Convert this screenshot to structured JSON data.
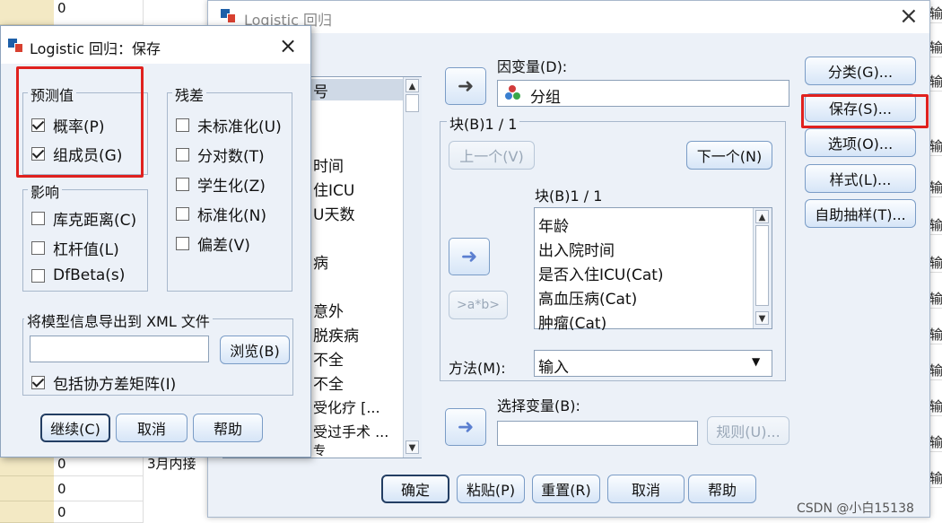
{
  "sheet": {
    "row_values": [
      "0",
      "0",
      "0"
    ],
    "third_col_text": "3月内接",
    "right_col_char": "输"
  },
  "main_dialog": {
    "title": "Logistic 回归",
    "variable_list": [
      "号",
      "",
      "",
      "时间",
      "住ICU",
      "U天数",
      "",
      "病",
      "",
      "",
      "意外",
      "脱疾病",
      "不全",
      "不全",
      "受化疗 [...",
      "受过手术 ...",
      "专"
    ],
    "dependent_label": "因变量(D):",
    "dependent_value": "分组",
    "block_label": "块(B)1 / 1",
    "prev_button": "上一个(V)",
    "next_button": "下一个(N)",
    "block_inner_label": "块(B)1 / 1",
    "covariates": [
      "年龄",
      "出入院时间",
      "是否入住ICU(Cat)",
      "高血压病(Cat)",
      "肿瘤(Cat)"
    ],
    "interaction_button": ">a*b>",
    "method_label": "方法(M):",
    "method_value": "输入",
    "selection_label": "选择变量(B):",
    "rule_button": "规则(U)...",
    "side_buttons": [
      "分类(G)...",
      "保存(S)...",
      "选项(O)...",
      "样式(L)...",
      "自助抽样(T)..."
    ],
    "bottom_buttons": [
      "确定",
      "粘贴(P)",
      "重置(R)",
      "取消",
      "帮助"
    ]
  },
  "save_dialog": {
    "title": "Logistic 回归：保存",
    "predicted_group": "预测值",
    "predicted_items": [
      {
        "label": "概率(P)",
        "checked": true
      },
      {
        "label": "组成员(G)",
        "checked": true
      }
    ],
    "influence_group": "影响",
    "influence_items": [
      {
        "label": "库克距离(C)",
        "checked": false
      },
      {
        "label": "杠杆值(L)",
        "checked": false
      },
      {
        "label": "DfBeta(s)",
        "checked": false
      }
    ],
    "residual_group": "残差",
    "residual_items": [
      {
        "label": "未标准化(U)",
        "checked": false
      },
      {
        "label": "分对数(T)",
        "checked": false
      },
      {
        "label": "学生化(Z)",
        "checked": false
      },
      {
        "label": "标准化(N)",
        "checked": false
      },
      {
        "label": "偏差(V)",
        "checked": false
      }
    ],
    "export_group": "将模型信息导出到 XML 文件",
    "export_path_value": "",
    "browse_button": "浏览(B)",
    "covariance_checkbox": {
      "label": "包括协方差矩阵(I)",
      "checked": true
    },
    "bottom_buttons": [
      "继续(C)",
      "取消",
      "帮助"
    ]
  },
  "watermark": "CSDN @小白15138",
  "colors": {
    "highlight": "#e0211e",
    "dialog_bg": "#ecf1f8",
    "button_border": "#7a9cc6"
  }
}
